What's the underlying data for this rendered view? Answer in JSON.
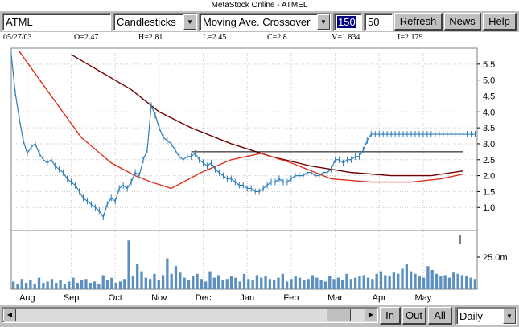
{
  "window": {
    "title": "MetaStock Online - ATMEL"
  },
  "toolbar": {
    "symbol": "ATML",
    "chart_style": "Candlesticks",
    "indicator": "Moving Ave. Crossover",
    "param1": "150",
    "param2": "50",
    "refresh_label": "Refresh",
    "news_label": "News",
    "help_label": "Help"
  },
  "quote": {
    "date": "05/27/03",
    "open": "O=2.47",
    "high": "H=2.81",
    "low": "L=2.45",
    "close": "C=2.8",
    "volume": "V=1.834",
    "indicator": "I=2.179"
  },
  "bottom": {
    "in_label": "In",
    "out_label": "Out",
    "all_label": "All",
    "period": "Daily"
  },
  "chart_data": {
    "type": "line",
    "price_ticks": [
      "5.5",
      "5.0",
      "4.5",
      "4.0",
      "3.5",
      "3.0",
      "2.5",
      "2.0",
      "1.5",
      "1.0"
    ],
    "ylim": [
      0.3,
      6.0
    ],
    "volume_tick": "25.0m",
    "volume_max": 45,
    "months": [
      "Aug",
      "Sep",
      "Oct",
      "Nov",
      "Dec",
      "Jan",
      "Feb",
      "Mar",
      "Apr",
      "May"
    ],
    "month_idx": [
      8,
      30,
      52,
      74,
      96,
      118,
      140,
      162,
      184,
      206
    ],
    "total_weeks": 233,
    "price": {
      "x": [
        0,
        2,
        4,
        6,
        8,
        10,
        12,
        14,
        16,
        18,
        20,
        22,
        24,
        26,
        28,
        30,
        32,
        34,
        36,
        38,
        40,
        42,
        44,
        46,
        48,
        50,
        52,
        54,
        56,
        58,
        60,
        62,
        64,
        66,
        68,
        70,
        72,
        74,
        76,
        78,
        80,
        82,
        84,
        86,
        88,
        90,
        92,
        94,
        96,
        98,
        100,
        102,
        104,
        106,
        108,
        110,
        112,
        114,
        116,
        118,
        120,
        122,
        124,
        126,
        128,
        130,
        132,
        134,
        136,
        138,
        140,
        142,
        144,
        146,
        148,
        150,
        152,
        154,
        156,
        158,
        160,
        162,
        164,
        166,
        168,
        170,
        172,
        174,
        176,
        178,
        180,
        182,
        184,
        186,
        188,
        190,
        192,
        194,
        196,
        198,
        200,
        202,
        204,
        206,
        208,
        210,
        212,
        214,
        216,
        218,
        220,
        222,
        224,
        226,
        228,
        230,
        232
      ],
      "y": [
        5.8,
        4.6,
        3.8,
        3.1,
        2.7,
        2.9,
        3.0,
        2.7,
        2.5,
        2.4,
        2.5,
        2.3,
        2.2,
        2.1,
        1.9,
        1.8,
        1.7,
        1.5,
        1.3,
        1.2,
        1.1,
        1.0,
        0.9,
        0.7,
        1.1,
        1.3,
        1.2,
        1.6,
        1.7,
        1.6,
        1.8,
        2.1,
        2.0,
        2.5,
        2.8,
        4.2,
        3.9,
        3.5,
        3.2,
        3.1,
        3.0,
        2.8,
        2.6,
        2.5,
        2.6,
        2.6,
        2.7,
        2.5,
        2.4,
        2.3,
        2.4,
        2.2,
        2.1,
        2.0,
        1.9,
        1.9,
        1.8,
        1.7,
        1.7,
        1.6,
        1.6,
        1.5,
        1.5,
        1.6,
        1.7,
        1.8,
        1.8,
        1.9,
        1.8,
        1.8,
        1.9,
        2.0,
        2.0,
        2.0,
        2.1,
        2.1,
        2.0,
        2.0,
        2.1,
        2.1,
        2.2,
        2.5,
        2.5,
        2.4,
        2.5,
        2.5,
        2.6,
        2.6,
        2.8,
        3.1,
        3.3,
        3.3,
        3.3,
        3.3,
        3.3,
        3.3,
        3.3,
        3.3,
        3.3,
        3.3,
        3.3,
        3.3,
        3.3,
        3.3,
        3.3,
        3.3,
        3.3,
        3.3,
        3.3,
        3.3,
        3.3,
        3.3,
        3.3,
        3.3,
        3.3,
        3.3,
        3.3
      ]
    },
    "ma_long": {
      "x": [
        30,
        60,
        74,
        90,
        110,
        130,
        150,
        170,
        190,
        210,
        226
      ],
      "y": [
        5.8,
        4.7,
        4.0,
        3.5,
        3.0,
        2.6,
        2.3,
        2.1,
        2.0,
        2.0,
        2.15
      ]
    },
    "ma_short": {
      "x": [
        4,
        20,
        35,
        50,
        62,
        70,
        80,
        95,
        110,
        125,
        140,
        160,
        180,
        200,
        215,
        226
      ],
      "y": [
        5.9,
        4.5,
        3.2,
        2.4,
        2.0,
        1.8,
        1.6,
        2.1,
        2.5,
        2.7,
        2.4,
        1.9,
        1.8,
        1.8,
        1.9,
        2.05
      ]
    },
    "crossover_level": 2.75,
    "crossover_x": [
      90,
      226
    ],
    "volume": [
      6,
      4,
      8,
      5,
      7,
      4,
      9,
      5,
      6,
      8,
      5,
      7,
      4,
      6,
      9,
      5,
      7,
      8,
      5,
      6,
      4,
      11,
      7,
      9,
      5,
      6,
      8,
      38,
      10,
      20,
      14,
      9,
      8,
      12,
      7,
      11,
      24,
      12,
      18,
      13,
      9,
      7,
      10,
      12,
      8,
      6,
      14,
      9,
      11,
      7,
      8,
      10,
      9,
      6,
      12,
      8,
      7,
      11,
      9,
      10,
      8,
      7,
      9,
      12,
      6,
      8,
      10,
      9,
      7,
      8,
      11,
      9,
      7,
      6,
      10,
      8,
      9,
      7,
      12,
      8,
      9,
      10,
      11,
      9,
      8,
      12,
      14,
      11,
      10,
      13,
      12,
      16,
      20,
      14,
      12,
      10,
      9,
      18,
      15,
      12,
      10,
      11,
      9,
      13,
      12,
      11,
      10,
      9,
      8
    ]
  }
}
